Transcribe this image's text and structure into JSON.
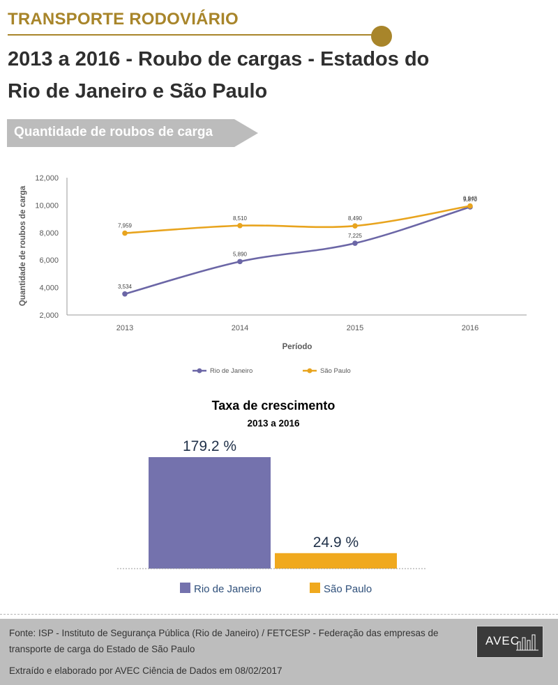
{
  "header": {
    "kicker": "TRANSPORTE RODOVIÁRIO",
    "title": "2013 a 2016  - Roubo de cargas - Estados do Rio de Janeiro e São Paulo",
    "accent_color": "#a8852a"
  },
  "section": {
    "label": "Quantidade de roubos de carga",
    "banner_color": "#bcbcbc"
  },
  "chart_data": [
    {
      "type": "line",
      "x": [
        "2013",
        "2014",
        "2015",
        "2016"
      ],
      "series": [
        {
          "name": "Rio de Janeiro",
          "values": [
            3534,
            5890,
            7225,
            9870
          ],
          "labels": [
            "3,534",
            "5,890",
            "7,225",
            "9,870"
          ],
          "color": "#6b66a6"
        },
        {
          "name": "São Paulo",
          "values": [
            7959,
            8510,
            8490,
            9943
          ],
          "labels": [
            "7,959",
            "8,510",
            "8,490",
            "9,943"
          ],
          "color": "#e8a41e"
        }
      ],
      "xlabel": "Período",
      "ylabel": "Quantidade de roubos de carga",
      "ylim": [
        2000,
        12000
      ],
      "yticks": [
        2000,
        4000,
        6000,
        8000,
        10000,
        12000
      ],
      "ytick_labels": [
        "2,000",
        "4,000",
        "6,000",
        "8,000",
        "10,000",
        "12,000"
      ],
      "grid": false,
      "legend": "bottom"
    },
    {
      "type": "bar",
      "title": "Taxa de crescimento",
      "subtitle": "2013 a 2016",
      "categories": [
        "Rio de Janeiro",
        "São Paulo"
      ],
      "values": [
        179.2,
        24.9
      ],
      "labels": [
        "179.2 %",
        "24.9 %"
      ],
      "colors": [
        "#7472ad",
        "#f0a91e"
      ],
      "ylim": [
        0,
        179.2
      ],
      "legend": "bottom"
    }
  ],
  "footer": {
    "source": "Fonte: ISP - Instituto de Segurança Pública (Rio de Janeiro) / FETCESP - Federação das empresas de transporte de carga do Estado de São Paulo",
    "credit": "Extraído e elaborado por AVEC Ciência de Dados em 08/02/2017",
    "logo_text": "AVEC"
  }
}
